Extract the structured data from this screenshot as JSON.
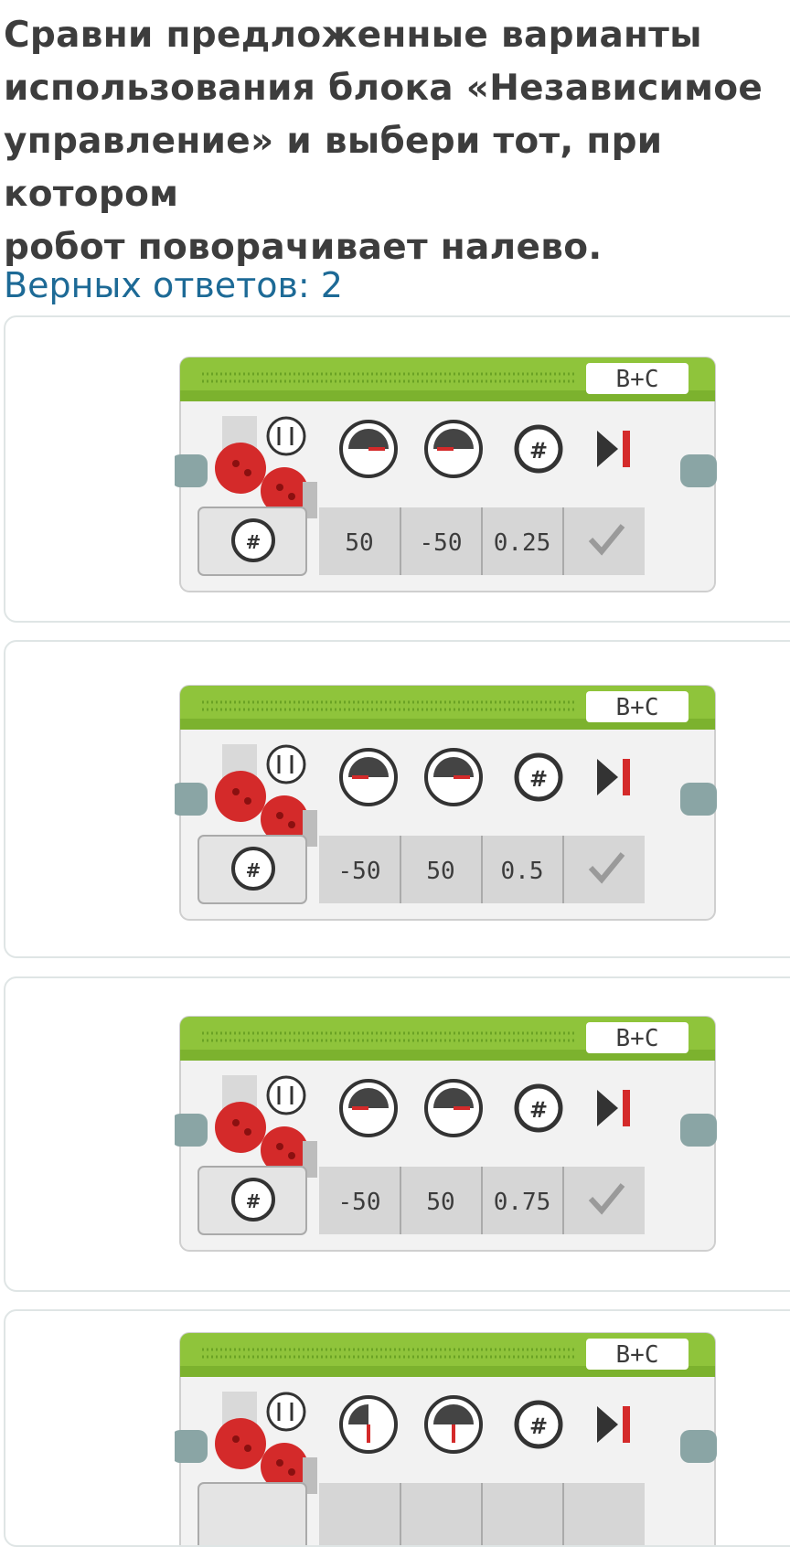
{
  "question": {
    "text": "Сравни предложенные варианты\nиспользования блока «Независимое\nуправление» и выбери тот, при котором\nробот поворачивает налево.",
    "answers_label": "Верных ответов: 2"
  },
  "options": [
    {
      "ports": "B+C",
      "left_power": "50",
      "right_power": "-50",
      "rotations": "0.25",
      "brake_icon": "checkmark-icon",
      "left_needle": "right",
      "right_needle": "left"
    },
    {
      "ports": "B+C",
      "left_power": "-50",
      "right_power": "50",
      "rotations": "0.5",
      "brake_icon": "checkmark-icon",
      "left_needle": "left",
      "right_needle": "right"
    },
    {
      "ports": "B+C",
      "left_power": "-50",
      "right_power": "50",
      "rotations": "0.75",
      "brake_icon": "checkmark-icon",
      "left_needle": "left",
      "right_needle": "right"
    },
    {
      "ports": "B+C",
      "left_power": "",
      "right_power": "",
      "rotations": "",
      "brake_icon": "checkmark-icon",
      "left_needle": "down",
      "right_needle": "down"
    }
  ],
  "colors": {
    "header_green": "#8fc43b",
    "motor_red": "#d42a2a",
    "question_text": "#3d3d3d",
    "count_text": "#1d6a96"
  }
}
